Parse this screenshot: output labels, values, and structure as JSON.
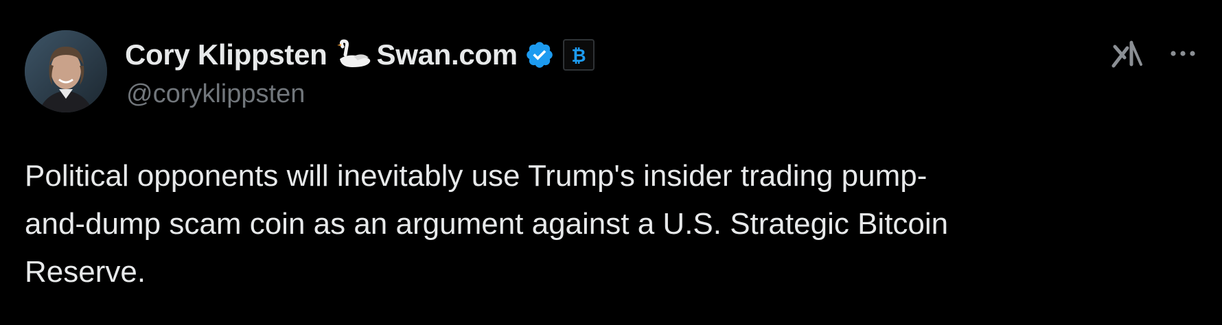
{
  "author": {
    "name_part1": "Cory Klippsten",
    "name_part2": "Swan.com",
    "handle": "@coryklippsten",
    "verified": true,
    "verified_color": "#1d9bf0",
    "affiliate_badge": "bitcoin-icon",
    "affiliate_color": "#1d9bf0",
    "name_emoji": "swan-icon"
  },
  "tweet": {
    "text_lines": [
      "Political opponents will inevitably use Trump's insider trading pump-",
      "and-dump scam coin as an argument against a U.S. Strategic Bitcoin",
      "Reserve."
    ]
  },
  "actions": {
    "grok": "grok-icon",
    "more": "more-icon"
  },
  "colors": {
    "background": "#000000",
    "primary_text": "#e7e9ea",
    "secondary_text": "#71767b"
  }
}
